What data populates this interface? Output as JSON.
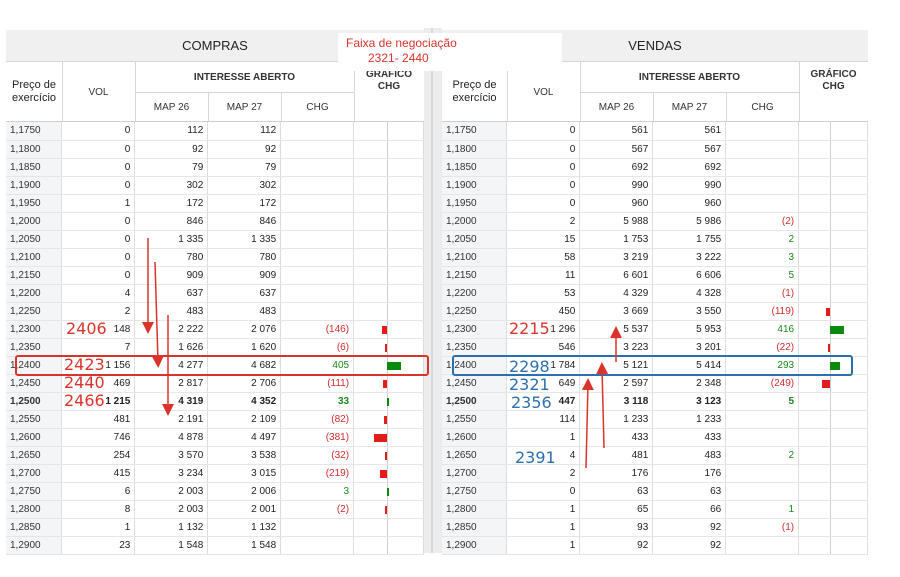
{
  "range_note": {
    "line1": "Faixa de negociação",
    "line2": "2321- 2440"
  },
  "compras": {
    "title": "COMPRAS",
    "headers": {
      "strike": "Preço de exercício",
      "vol": "VOL",
      "open_interest": "INTERESSE ABERTO",
      "map26": "MAP 26",
      "map27": "MAP 27",
      "chg": "CHG",
      "chart": "GRÁFICO CHG"
    },
    "rows": [
      {
        "strike": "1,1750",
        "vol": "0",
        "m26": "112",
        "m27": "112",
        "chg": "",
        "bar": 0
      },
      {
        "strike": "1,1800",
        "vol": "0",
        "m26": "92",
        "m27": "92",
        "chg": "",
        "bar": 0
      },
      {
        "strike": "1,1850",
        "vol": "0",
        "m26": "79",
        "m27": "79",
        "chg": "",
        "bar": 0
      },
      {
        "strike": "1,1900",
        "vol": "0",
        "m26": "302",
        "m27": "302",
        "chg": "",
        "bar": 0
      },
      {
        "strike": "1,1950",
        "vol": "1",
        "m26": "172",
        "m27": "172",
        "chg": "",
        "bar": 0
      },
      {
        "strike": "1,2000",
        "vol": "0",
        "m26": "846",
        "m27": "846",
        "chg": "",
        "bar": 0
      },
      {
        "strike": "1,2050",
        "vol": "0",
        "m26": "1 335",
        "m27": "1 335",
        "chg": "",
        "bar": 0
      },
      {
        "strike": "1,2100",
        "vol": "0",
        "m26": "780",
        "m27": "780",
        "chg": "",
        "bar": 0
      },
      {
        "strike": "1,2150",
        "vol": "0",
        "m26": "909",
        "m27": "909",
        "chg": "",
        "bar": 0
      },
      {
        "strike": "1,2200",
        "vol": "4",
        "m26": "637",
        "m27": "637",
        "chg": "",
        "bar": 0
      },
      {
        "strike": "1,2250",
        "vol": "2",
        "m26": "483",
        "m27": "483",
        "chg": "",
        "bar": 0
      },
      {
        "strike": "1,2300",
        "vol": "148",
        "m26": "2 222",
        "m27": "2 076",
        "chg": "(146)",
        "bar": -146
      },
      {
        "strike": "1,2350",
        "vol": "7",
        "m26": "1 626",
        "m27": "1 620",
        "chg": "(6)",
        "bar": -6
      },
      {
        "strike": "1,2400",
        "vol": "1 156",
        "m26": "4 277",
        "m27": "4 682",
        "chg": "405",
        "bar": 405
      },
      {
        "strike": "1,2450",
        "vol": "469",
        "m26": "2 817",
        "m27": "2 706",
        "chg": "(111)",
        "bar": -111
      },
      {
        "strike": "1,2500",
        "vol": "1 215",
        "m26": "4 319",
        "m27": "4 352",
        "chg": "33",
        "bar": 33
      },
      {
        "strike": "1,2550",
        "vol": "481",
        "m26": "2 191",
        "m27": "2 109",
        "chg": "(82)",
        "bar": -82
      },
      {
        "strike": "1,2600",
        "vol": "746",
        "m26": "4 878",
        "m27": "4 497",
        "chg": "(381)",
        "bar": -381
      },
      {
        "strike": "1,2650",
        "vol": "254",
        "m26": "3 570",
        "m27": "3 538",
        "chg": "(32)",
        "bar": -32
      },
      {
        "strike": "1,2700",
        "vol": "415",
        "m26": "3 234",
        "m27": "3 015",
        "chg": "(219)",
        "bar": -219
      },
      {
        "strike": "1,2750",
        "vol": "6",
        "m26": "2 003",
        "m27": "2 006",
        "chg": "3",
        "bar": 3
      },
      {
        "strike": "1,2800",
        "vol": "8",
        "m26": "2 003",
        "m27": "2 001",
        "chg": "(2)",
        "bar": -2
      },
      {
        "strike": "1,2850",
        "vol": "1",
        "m26": "1 132",
        "m27": "1 132",
        "chg": "",
        "bar": 0
      },
      {
        "strike": "1,2900",
        "vol": "23",
        "m26": "1 548",
        "m27": "1 548",
        "chg": "",
        "bar": 0
      }
    ]
  },
  "vendas": {
    "title": "VENDAS",
    "headers": {
      "strike": "Preço de exercício",
      "vol": "VOL",
      "open_interest": "INTERESSE ABERTO",
      "map26": "MAP 26",
      "map27": "MAP 27",
      "chg": "CHG",
      "chart": "GRÁFICO CHG"
    },
    "rows": [
      {
        "strike": "1,1750",
        "vol": "0",
        "m26": "561",
        "m27": "561",
        "chg": "",
        "bar": 0
      },
      {
        "strike": "1,1800",
        "vol": "0",
        "m26": "567",
        "m27": "567",
        "chg": "",
        "bar": 0
      },
      {
        "strike": "1,1850",
        "vol": "0",
        "m26": "692",
        "m27": "692",
        "chg": "",
        "bar": 0
      },
      {
        "strike": "1,1900",
        "vol": "0",
        "m26": "990",
        "m27": "990",
        "chg": "",
        "bar": 0
      },
      {
        "strike": "1,1950",
        "vol": "0",
        "m26": "960",
        "m27": "960",
        "chg": "",
        "bar": 0
      },
      {
        "strike": "1,2000",
        "vol": "2",
        "m26": "5 988",
        "m27": "5 986",
        "chg": "(2)",
        "bar": 0
      },
      {
        "strike": "1,2050",
        "vol": "15",
        "m26": "1 753",
        "m27": "1 755",
        "chg": "2",
        "bar": 0
      },
      {
        "strike": "1,2100",
        "vol": "58",
        "m26": "3 219",
        "m27": "3 222",
        "chg": "3",
        "bar": 0
      },
      {
        "strike": "1,2150",
        "vol": "11",
        "m26": "6 601",
        "m27": "6 606",
        "chg": "5",
        "bar": 0
      },
      {
        "strike": "1,2200",
        "vol": "53",
        "m26": "4 329",
        "m27": "4 328",
        "chg": "(1)",
        "bar": 0
      },
      {
        "strike": "1,2250",
        "vol": "450",
        "m26": "3 669",
        "m27": "3 550",
        "chg": "(119)",
        "bar": -119
      },
      {
        "strike": "1,2300",
        "vol": "1 296",
        "m26": "5 537",
        "m27": "5 953",
        "chg": "416",
        "bar": 416
      },
      {
        "strike": "1,2350",
        "vol": "546",
        "m26": "3 223",
        "m27": "3 201",
        "chg": "(22)",
        "bar": -22
      },
      {
        "strike": "1,2400",
        "vol": "1 784",
        "m26": "5 121",
        "m27": "5 414",
        "chg": "293",
        "bar": 293
      },
      {
        "strike": "1,2450",
        "vol": "649",
        "m26": "2 597",
        "m27": "2 348",
        "chg": "(249)",
        "bar": -249
      },
      {
        "strike": "1,2500",
        "vol": "447",
        "m26": "3 118",
        "m27": "3 123",
        "chg": "5",
        "bar": 0
      },
      {
        "strike": "1,2550",
        "vol": "114",
        "m26": "1 233",
        "m27": "1 233",
        "chg": "",
        "bar": 0
      },
      {
        "strike": "1,2600",
        "vol": "1",
        "m26": "433",
        "m27": "433",
        "chg": "",
        "bar": 0
      },
      {
        "strike": "1,2650",
        "vol": "4",
        "m26": "481",
        "m27": "483",
        "chg": "2",
        "bar": 0
      },
      {
        "strike": "1,2700",
        "vol": "2",
        "m26": "176",
        "m27": "176",
        "chg": "",
        "bar": 0
      },
      {
        "strike": "1,2750",
        "vol": "0",
        "m26": "63",
        "m27": "63",
        "chg": "",
        "bar": 0
      },
      {
        "strike": "1,2800",
        "vol": "1",
        "m26": "65",
        "m27": "66",
        "chg": "1",
        "bar": 0
      },
      {
        "strike": "1,2850",
        "vol": "1",
        "m26": "93",
        "m27": "92",
        "chg": "(1)",
        "bar": 0
      },
      {
        "strike": "1,2900",
        "vol": "1",
        "m26": "92",
        "m27": "92",
        "chg": "",
        "bar": 0
      }
    ]
  },
  "annotations": {
    "left": [
      "2406",
      "2423",
      "2440",
      "2466"
    ],
    "right": [
      "2215",
      "2298",
      "2321",
      "2356",
      "2391"
    ]
  },
  "colors": {
    "note_red": "#d9342b",
    "note_blue": "#2c6fae",
    "up": "#0b8a0b",
    "down": "#e31b1b"
  }
}
